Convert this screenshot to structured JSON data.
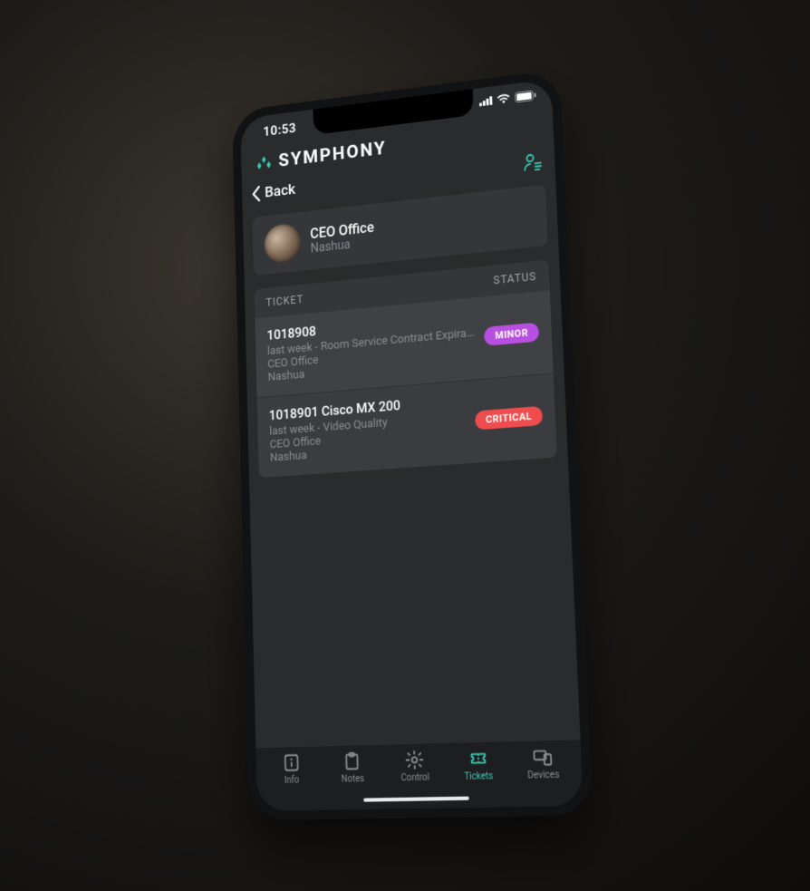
{
  "statusbar": {
    "time": "10:53"
  },
  "app": {
    "name": "SYMPHONY"
  },
  "nav": {
    "back_label": "Back"
  },
  "room": {
    "name": "CEO Office",
    "location": "Nashua"
  },
  "section": {
    "ticket_label": "TICKET",
    "status_label": "STATUS"
  },
  "tickets": [
    {
      "id": "1018908",
      "device": "",
      "when": "last week",
      "desc": "Room Service Contract Expirati…",
      "room": "CEO Office",
      "location": "Nashua",
      "status": "MINOR"
    },
    {
      "id": "1018901",
      "device": "Cisco MX 200",
      "when": "last week",
      "desc": "Video Quality",
      "room": "CEO Office",
      "location": "Nashua",
      "status": "CRITICAL"
    }
  ],
  "tabs": {
    "info": "Info",
    "notes": "Notes",
    "control": "Control",
    "tickets": "Tickets",
    "devices": "Devices",
    "active": "tickets"
  },
  "colors": {
    "accent": "#38cbb3",
    "minor": "#b94fe0",
    "critical": "#ef4d4d"
  }
}
